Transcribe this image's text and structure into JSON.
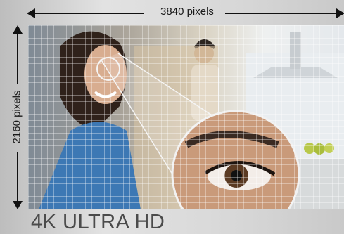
{
  "dimensions": {
    "width_label": "3840 pixels",
    "height_label": "2160 pixels"
  },
  "brand": {
    "title": "4K ULTRA HD"
  },
  "image": {
    "description_icon": "photo-woman-smiling-kitchen",
    "zoom_icon": "magnified-eye-icon"
  }
}
